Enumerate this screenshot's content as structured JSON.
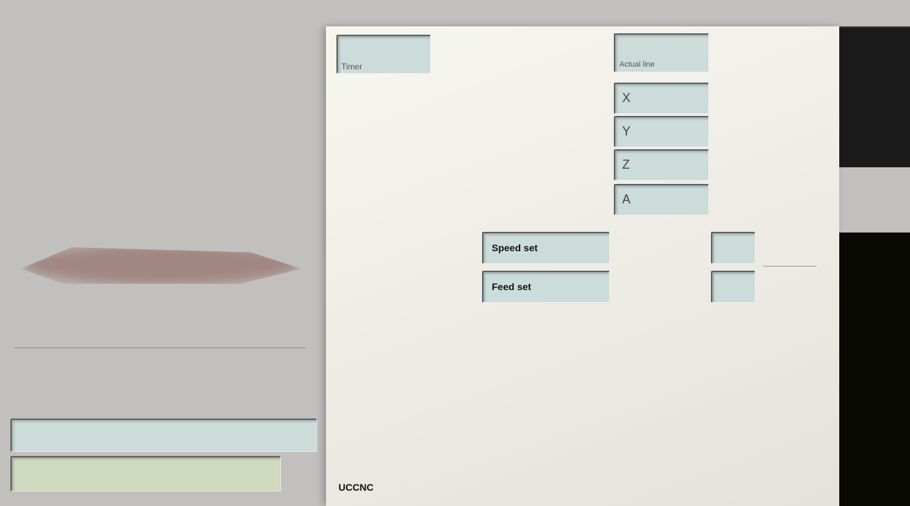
{
  "app": {
    "brand": "UCCNC"
  },
  "dro": {
    "timer_label": "Timer",
    "actual_line_label": "Actual line",
    "axes": [
      {
        "label": "X",
        "value": ""
      },
      {
        "label": "Y",
        "value": ""
      },
      {
        "label": "Z",
        "value": ""
      },
      {
        "label": "A",
        "value": ""
      }
    ]
  },
  "settings": {
    "speed_label": "Speed set",
    "feed_label": "Feed set",
    "speed_value": "",
    "feed_value": ""
  },
  "mdi": {
    "value": ""
  },
  "status": {
    "text": ""
  }
}
